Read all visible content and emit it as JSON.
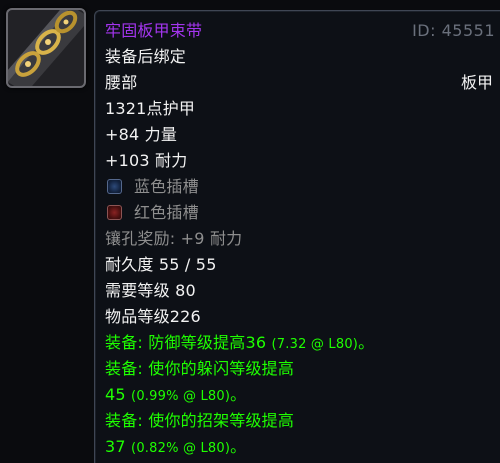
{
  "item": {
    "name": "牢固板甲束带",
    "id_label": "ID: 45551",
    "bind": "装备后绑定",
    "slot": "腰部",
    "armor_type": "板甲",
    "armor": "1321点护甲",
    "stats": [
      "+84 力量",
      "+103 耐力"
    ],
    "sockets": [
      {
        "color": "blue",
        "label": "蓝色插槽"
      },
      {
        "color": "red",
        "label": "红色插槽"
      }
    ],
    "socket_bonus": "镶孔奖励: +9 耐力",
    "durability": "耐久度 55 / 55",
    "required_level": "需要等级 80",
    "item_level": "物品等级226",
    "equip_effects": [
      {
        "prefix": "装备:  防御等级提高36 ",
        "detail": "(7.32 @ L80)",
        "suffix": "。"
      },
      {
        "line1": "装备:  使你的躲闪等级提高",
        "line2_value": "45 ",
        "detail": "(0.99% @ L80)",
        "suffix": "。"
      },
      {
        "line1": "装备:  使你的招架等级提高",
        "line2_value": "37 ",
        "detail": "(0.82% @ L80)",
        "suffix": "。"
      }
    ]
  },
  "colors": {
    "epic": "#a335ee",
    "equip_green": "#1eff00",
    "gray": "#8e8e8e",
    "background": "#0d1016"
  },
  "icon": {
    "name": "plate-belt-icon"
  }
}
